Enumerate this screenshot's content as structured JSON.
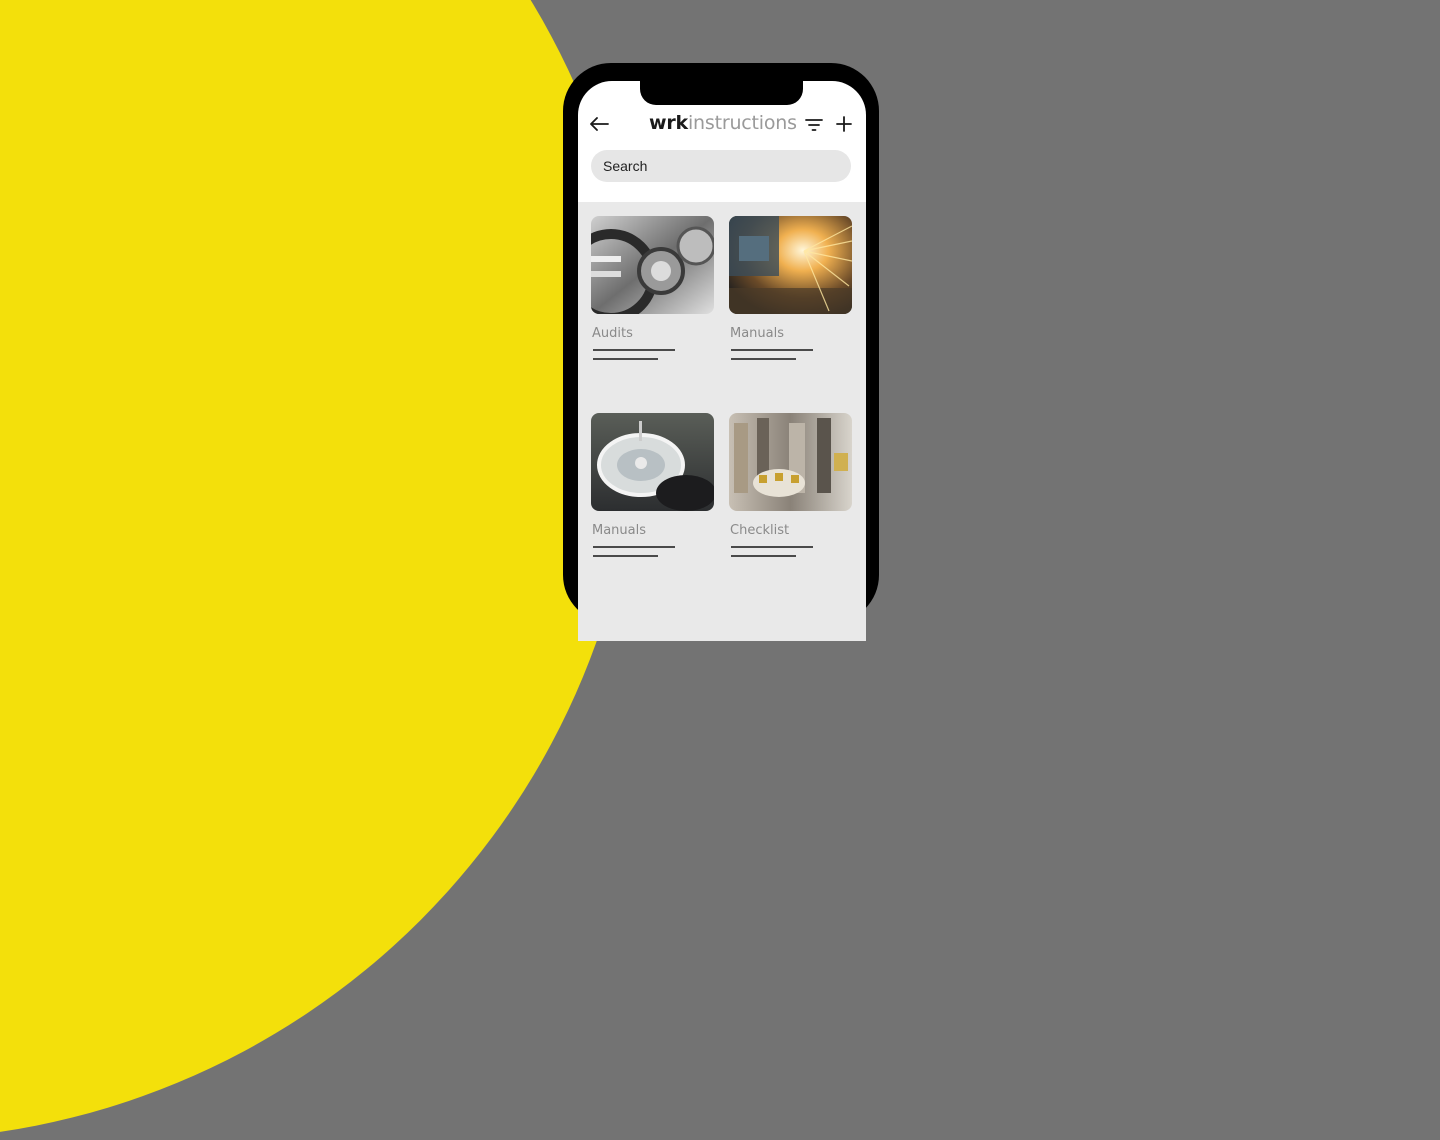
{
  "background": {
    "left_color": "#f3e00b",
    "right_color": "#737373"
  },
  "app": {
    "logo_bold": "wrk",
    "logo_light": "instructions",
    "icons": {
      "back": "arrow-left-icon",
      "filter": "filter-icon",
      "add": "plus-icon"
    }
  },
  "search": {
    "placeholder": "Search",
    "value": ""
  },
  "cards": [
    {
      "label": "Audits",
      "image": "gears-machinery"
    },
    {
      "label": "Manuals",
      "image": "laser-sparks"
    },
    {
      "label": "Manuals",
      "image": "rotary-assembly-machine"
    },
    {
      "label": "Checklist",
      "image": "milling-cutter-tools"
    }
  ]
}
